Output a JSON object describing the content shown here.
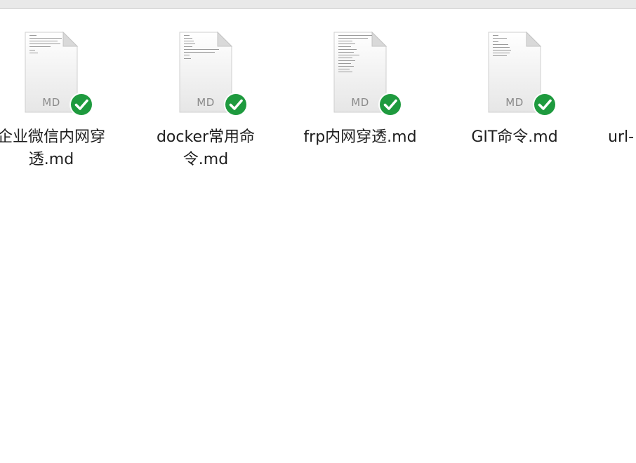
{
  "files": [
    {
      "name_line1": "企业微信内网穿",
      "name_line2": "透.md",
      "badge": "MD",
      "status_icon": "checkmark-circle-icon",
      "status_color": "#1e9a3e"
    },
    {
      "name_line1": "docker常用命",
      "name_line2": "令.md",
      "badge": "MD",
      "status_icon": "checkmark-circle-icon",
      "status_color": "#1e9a3e"
    },
    {
      "name_line1": "frp内网穿透.md",
      "name_line2": "",
      "badge": "MD",
      "status_icon": "checkmark-circle-icon",
      "status_color": "#1e9a3e"
    },
    {
      "name_line1": "GIT命令.md",
      "name_line2": "",
      "badge": "MD",
      "status_icon": "checkmark-circle-icon",
      "status_color": "#1e9a3e"
    },
    {
      "name_line1": "url-",
      "name_line2": "",
      "badge": "",
      "status_icon": "",
      "status_color": ""
    }
  ]
}
